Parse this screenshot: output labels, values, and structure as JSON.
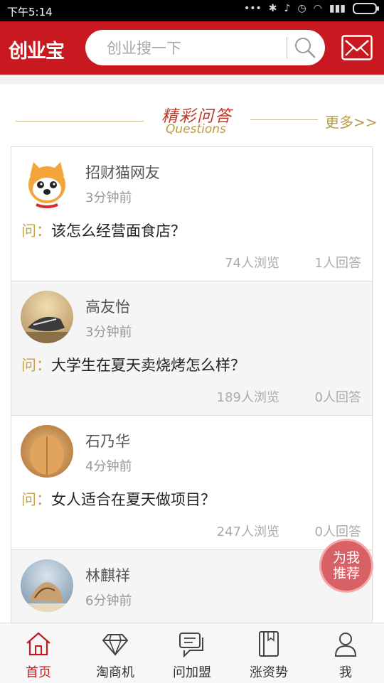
{
  "status": {
    "time": "下午5:14"
  },
  "header": {
    "logo": "创业宝",
    "search_placeholder": "创业搜一下"
  },
  "section": {
    "title": "精彩问答",
    "subtitle": "Questions",
    "more": "更多>>"
  },
  "questions": [
    {
      "name": "招财猫网友",
      "time": "3分钟前",
      "q_label": "问：",
      "question": "该怎么经营面食店？",
      "views": "74人浏览",
      "answers": "1人回答"
    },
    {
      "name": "高友怡",
      "time": "3分钟前",
      "q_label": "问：",
      "question": "大学生在夏天卖烧烤怎么样？",
      "views": "189人浏览",
      "answers": "0人回答"
    },
    {
      "name": "石乃华",
      "time": "4分钟前",
      "q_label": "问：",
      "question": "女人适合在夏天做项目？",
      "views": "247人浏览",
      "answers": "0人回答"
    },
    {
      "name": "林麒祥",
      "time": "6分钟前"
    }
  ],
  "recommend": {
    "line1": "为我",
    "line2": "推荐"
  },
  "tabs": [
    {
      "label": "首页",
      "icon": "home-icon",
      "active": true
    },
    {
      "label": "淘商机",
      "icon": "diamond-icon"
    },
    {
      "label": "问加盟",
      "icon": "chat-icon"
    },
    {
      "label": "涨资势",
      "icon": "book-icon"
    },
    {
      "label": "我",
      "icon": "user-icon"
    }
  ],
  "colors": {
    "brand": "#c81921",
    "accent": "#b89b45"
  }
}
